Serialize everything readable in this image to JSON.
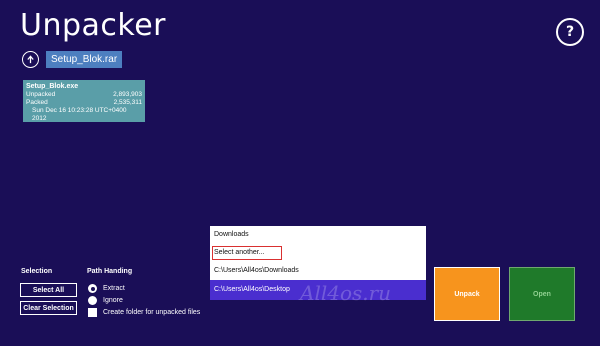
{
  "app": {
    "title": "Unpacker",
    "help_label": "?"
  },
  "archive": {
    "name": "Setup_Blok.rar"
  },
  "file": {
    "name": "Setup_Blok.exe",
    "unpacked_label": "Unpacked",
    "unpacked_value": "2,893,903",
    "packed_label": "Packed",
    "packed_value": "2,535,311",
    "date": "Sun Dec 16 10:23:28 UTC+0400 2012"
  },
  "selection": {
    "label": "Selection",
    "select_all": "Select All",
    "clear_selection": "Clear Selection"
  },
  "path_handling": {
    "label": "Path Handing",
    "options": [
      "Extract",
      "Ignore"
    ],
    "checked_option": "Extract",
    "create_folder": "Create folder for unpacked files"
  },
  "destination": {
    "items": [
      "Downloads",
      "Select another...",
      "C:\\Users\\All4os\\Downloads",
      "C:\\Users\\All4os\\Desktop"
    ],
    "selected": "C:\\Users\\All4os\\Desktop",
    "highlighted": "Select another..."
  },
  "actions": {
    "unpack": "Unpack",
    "open": "Open"
  },
  "watermark": "All4os.ru",
  "colors": {
    "background": "#1a0e57",
    "tile_unpack": "#f7941d",
    "tile_open": "#1f7a2a",
    "selected_item": "#4a2ecf",
    "file_tile": "#5a9ea8"
  }
}
